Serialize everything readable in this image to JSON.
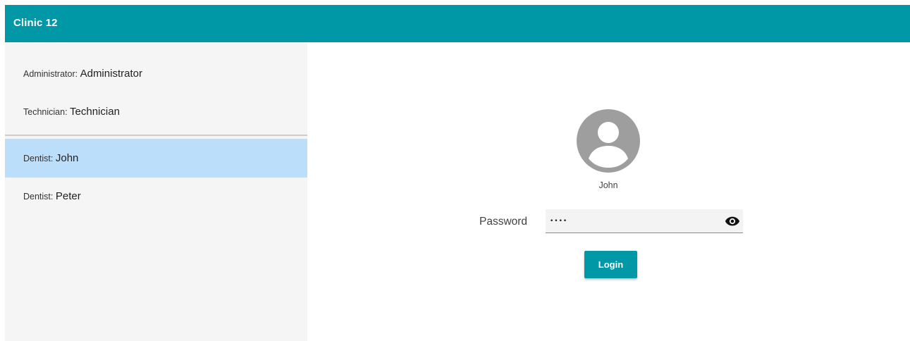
{
  "header": {
    "title": "Clinic 12",
    "background": "#0097a7"
  },
  "sidebar": {
    "users": [
      {
        "role": "Administrator:",
        "name": "Administrator",
        "selected": false
      },
      {
        "role": "Technician:",
        "name": "Technician",
        "selected": false
      },
      {
        "role": "Dentist:",
        "name": "John",
        "selected": true
      },
      {
        "role": "Dentist:",
        "name": "Peter",
        "selected": false
      }
    ],
    "selected_color": "#bbdefb"
  },
  "login": {
    "avatar_icon": "account-circle-icon",
    "selected_user": "John",
    "password_label": "Password",
    "password_value": "••••",
    "visibility_icon": "eye-icon",
    "login_label": "Login",
    "accent": "#0097a7"
  }
}
